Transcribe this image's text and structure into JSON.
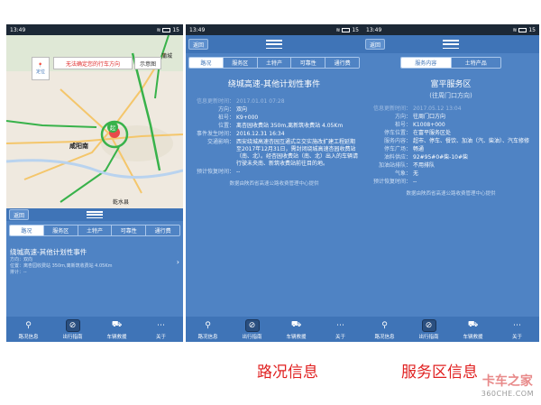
{
  "status": {
    "time": "13:49",
    "battery": "15"
  },
  "common": {
    "back_label": "返回",
    "nav": [
      {
        "label": "路况信息",
        "icon": "map-pin-icon"
      },
      {
        "label": "出行指南",
        "icon": "compass-icon"
      },
      {
        "label": "车辆救援",
        "icon": "tow-truck-icon"
      },
      {
        "label": "关于",
        "icon": "more-dots-icon"
      }
    ]
  },
  "tabs_road": [
    "路况",
    "服务区",
    "土特产",
    "可靠性",
    "通行费"
  ],
  "tabs_service": [
    "服务内容",
    "土特产品"
  ],
  "screen1": {
    "locate_label": "定位",
    "direction_hint": "无法确定您的行车方向",
    "legend_label": "示意图",
    "map_labels": {
      "city": "咸阳南",
      "start_badge": "起",
      "top_right": "蒲城",
      "bottom": "乾水县"
    },
    "event": {
      "title": "绕城高速-其他计划性事件",
      "line1": "方向：双向",
      "line2": "位置：离杏园收费站 350m,离新筑收费站 4.05Km",
      "line3": "排计：--"
    }
  },
  "screen2": {
    "title": "绕城高速-其他计划性事件",
    "rows": [
      {
        "k": "信息更新时间：",
        "v": "2017.01.01 07:28",
        "faint": true
      },
      {
        "k": "方向：",
        "v": "双向"
      },
      {
        "k": "桩号：",
        "v": "K9+000"
      },
      {
        "k": "位置：",
        "v": "离杏园收费站 350m,离新筑收费站 4.05Km"
      },
      {
        "k": "事件发生时间：",
        "v": "2016.12.31 16:34"
      },
      {
        "k": "交通影响：",
        "v": "西安绕城高速杏园互通式立交实施改扩建工程延期至2017年12月31日，需封闭绕城高速杏园收费站（南、北）。经杏园收费站（南、北）出入的车辆请行驶未央南、新筑收费站前往目的地。"
      },
      {
        "k": "预计恢复时间：",
        "v": "--"
      }
    ],
    "source": "数据由陕西省高速公路收费管理中心提供"
  },
  "screen3": {
    "title": "富平服务区",
    "subtitle": "(往周门口方向)",
    "rows": [
      {
        "k": "信息更新时间：",
        "v": "2017.05.12 13:04",
        "faint": true
      },
      {
        "k": "方向：",
        "v": "往周门口方向"
      },
      {
        "k": "桩号：",
        "v": "K1008+000"
      },
      {
        "k": "停车位置：",
        "v": "在富平服务区处"
      },
      {
        "k": "服务内容：",
        "v": "超市、停车、餐饮、加油（汽、柴油）、汽车修修"
      },
      {
        "k": "停车广场：",
        "v": "畅通"
      },
      {
        "k": "油料供应：",
        "v": "92#95#0#柴-10#柴"
      },
      {
        "k": "加油站排队：",
        "v": "不用排队"
      },
      {
        "k": "气象：",
        "v": "无"
      },
      {
        "k": "预计恢复时间：",
        "v": "--"
      }
    ],
    "source": "数据由陕西省高速公路收费管理中心提供"
  },
  "captions": {
    "left": "路况信息",
    "right": "服务区信息"
  },
  "watermark": {
    "line1": "卡车之家",
    "line2": "360CHE.COM"
  },
  "colors": {
    "panel": "#4f83c4",
    "bar": "#3f74b7",
    "caption": "#e02020"
  }
}
